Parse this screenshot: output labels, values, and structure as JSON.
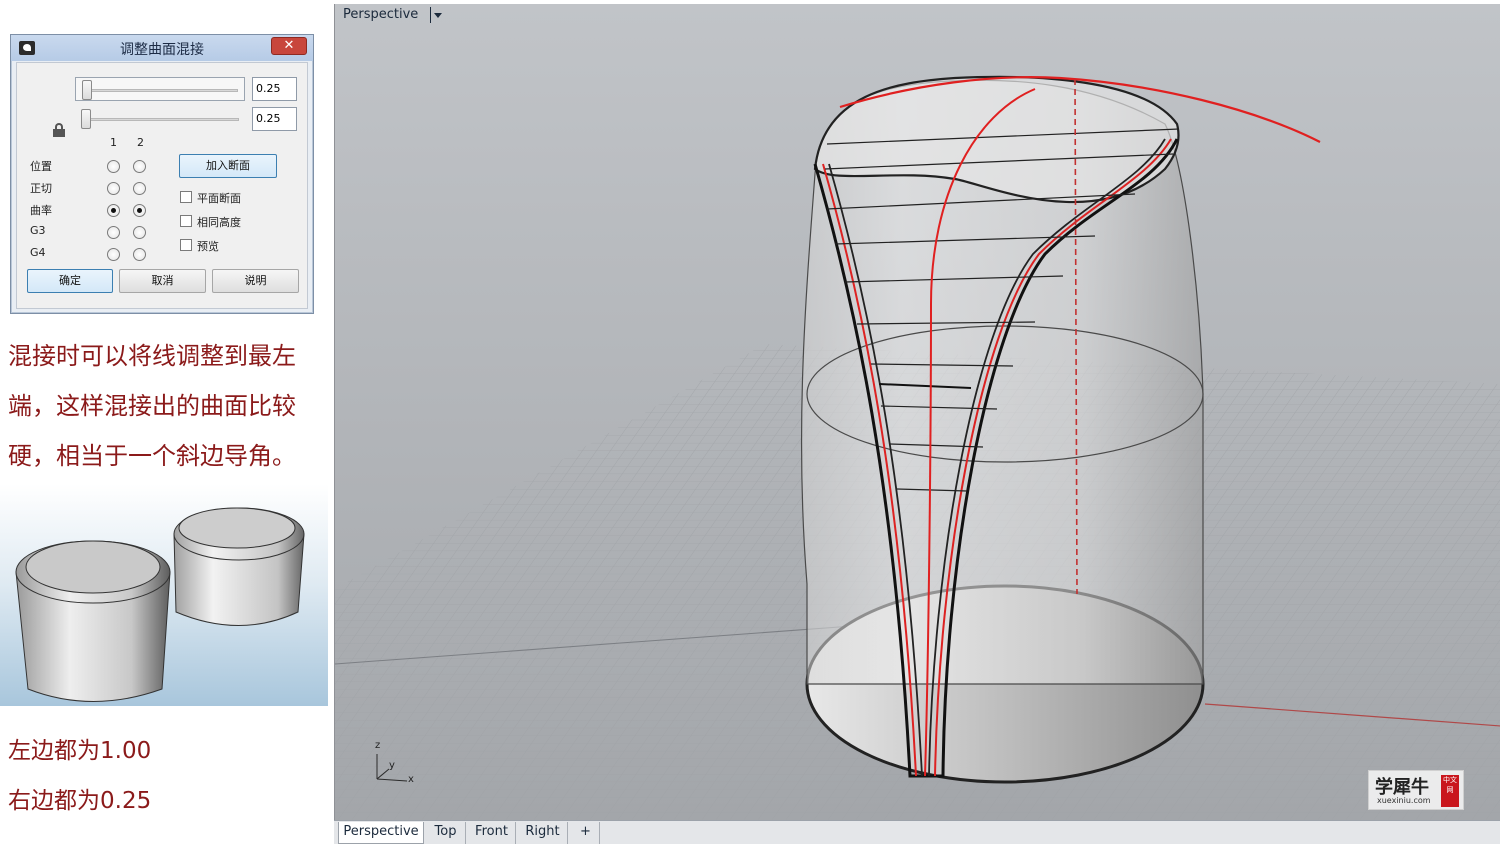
{
  "dialog": {
    "title": "调整曲面混接",
    "close_label": "✕",
    "slider1_value": "0.25",
    "slider2_value": "0.25",
    "col1": "1",
    "col2": "2",
    "rows": [
      {
        "label": "位置",
        "c1": false,
        "c2": false
      },
      {
        "label": "正切",
        "c1": false,
        "c2": false
      },
      {
        "label": "曲率",
        "c1": true,
        "c2": true
      },
      {
        "label": "G3",
        "c1": false,
        "c2": false
      },
      {
        "label": "G4",
        "c1": false,
        "c2": false
      }
    ],
    "add_section_label": "加入断面",
    "options": [
      {
        "label": "平面断面",
        "checked": false
      },
      {
        "label": "相同高度",
        "checked": false
      },
      {
        "label": "预览",
        "checked": false
      }
    ],
    "ok_label": "确定",
    "cancel_label": "取消",
    "help_label": "说明"
  },
  "description": {
    "line1": "混接时可以将线调整到最左",
    "line2": "端，这样混接出的曲面比较",
    "line3": "硬，相当于一个斜边导角。"
  },
  "caption": {
    "left": "左边都为1.00",
    "right": "右边都为0.25"
  },
  "viewport": {
    "label": "Perspective",
    "axis_z": "z",
    "axis_y": "y",
    "axis_x": "x"
  },
  "tabs": [
    "Perspective",
    "Top",
    "Front",
    "Right",
    "+"
  ],
  "watermark": {
    "name": "学犀牛",
    "url": "xuexiniu.com",
    "seal": "中文网"
  },
  "colors": {
    "accent_text": "#8b1a1a",
    "curve_red": "#e02020"
  }
}
